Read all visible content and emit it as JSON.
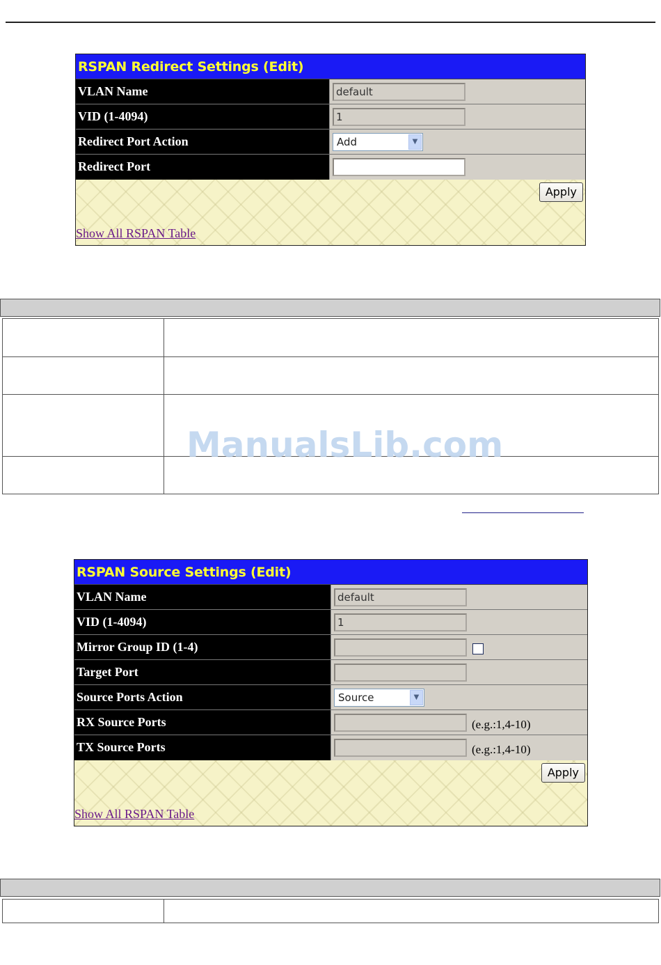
{
  "redirect_panel": {
    "title": "RSPAN Redirect Settings (Edit)",
    "rows": [
      {
        "label": "VLAN Name",
        "value": "default"
      },
      {
        "label": "VID (1-4094)",
        "value": "1"
      },
      {
        "label": "Redirect Port Action",
        "select": "Add"
      },
      {
        "label": "Redirect Port",
        "value": ""
      }
    ],
    "apply_label": "Apply",
    "show_all_label": "Show All RSPAN Table"
  },
  "source_panel": {
    "title": "RSPAN Source Settings (Edit)",
    "rows": [
      {
        "label": "VLAN Name",
        "value": "default"
      },
      {
        "label": "VID (1-4094)",
        "value": "1"
      },
      {
        "label": "Mirror Group ID (1-4)",
        "value": ""
      },
      {
        "label": "Target Port",
        "value": ""
      },
      {
        "label": "Source Ports Action",
        "select": "Source"
      },
      {
        "label": "RX Source Ports",
        "value": "",
        "hint": "(e.g.:1,4-10)"
      },
      {
        "label": "TX Source Ports",
        "value": "",
        "hint": "(e.g.:1,4-10)"
      }
    ],
    "apply_label": "Apply",
    "show_all_label": "Show All RSPAN Table"
  },
  "watermark": "ManualsLib.com",
  "icons": {
    "dropdown": "chevron-down-icon",
    "checkbox": "checkbox-icon"
  },
  "colors": {
    "title_bar": "#1a1af5",
    "title_text": "#ffff33",
    "label_bg": "#000000",
    "field_bg": "#d4d0c8",
    "footer_bg": "#f6f3c8"
  }
}
